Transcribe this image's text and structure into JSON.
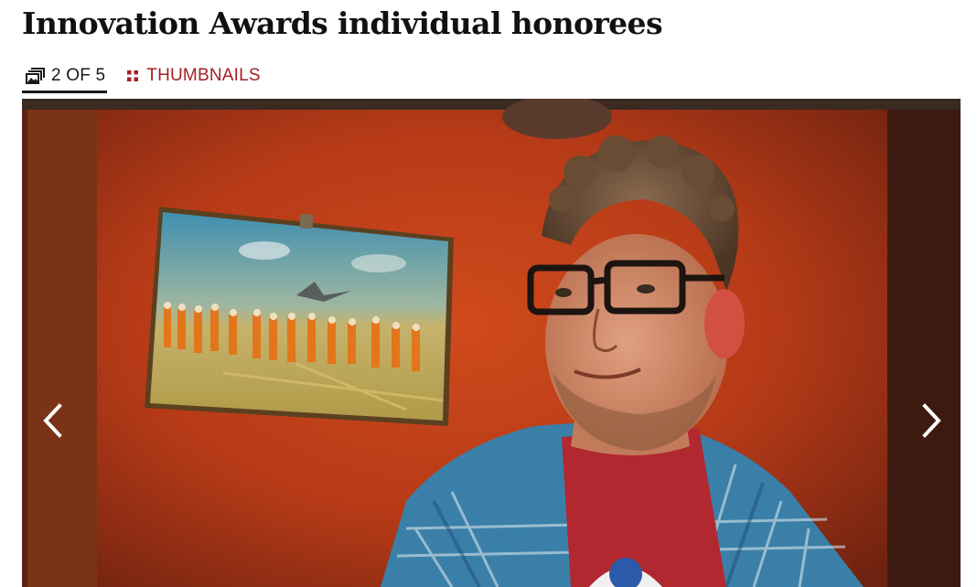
{
  "gallery": {
    "title": "Innovation Awards individual honorees",
    "counter_label": "2 OF 5",
    "thumbnails_label": "THUMBNAILS"
  },
  "icons": {
    "counter": "gallery-stack-icon",
    "thumbnails": "grid-dots-icon",
    "previous": "chevron-left-icon",
    "next": "chevron-right-icon"
  },
  "colors": {
    "accent": "#a41f23",
    "title": "#111111",
    "wall": "#c0401c"
  }
}
